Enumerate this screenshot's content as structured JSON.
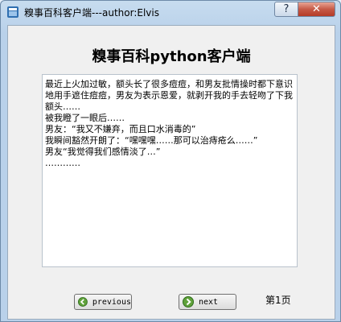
{
  "window": {
    "title": "糗事百科客户端---author:Elvis",
    "help_label": "?",
    "close_label": "✕"
  },
  "main": {
    "heading": "糗事百科python客户端",
    "content": "最近上火加过敏，额头长了很多痘痘，和男友批情操时都下意识地用手遮住痘痘，男友为表示恩爱，就剥开我的手去轻吻了下我额头……\n被我瞪了一眼后……\n男友：“我又不嫌弃，而且口水消毒的”\n我瞬间豁然开朗了：“嘿嘿嘿……那可以治痔疮么……”\n男友“我觉得我们感情淡了…”\n…………"
  },
  "buttons": {
    "previous_label": "previous",
    "next_label": "next"
  },
  "pagination": {
    "page_label": "第1页"
  },
  "colors": {
    "accent": "#5fa13a",
    "close": "#c65a47"
  },
  "icons": [
    "app-icon",
    "help-icon",
    "close-icon",
    "arrow-left-icon",
    "arrow-right-icon"
  ]
}
